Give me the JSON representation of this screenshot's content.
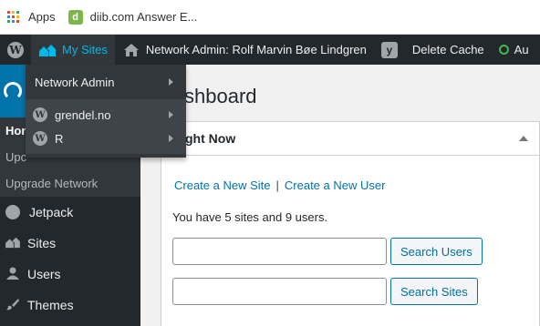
{
  "bookmarks": {
    "apps_label": "Apps",
    "diib_label": "diib.com Answer E..."
  },
  "adminbar": {
    "my_sites": "My Sites",
    "network_admin": "Network Admin: Rolf Marvin Bøe Lindgren",
    "delete_cache": "Delete Cache",
    "au": "Au"
  },
  "dropdown": {
    "network_admin": "Network Admin",
    "sites": [
      {
        "label": "grendel.no"
      },
      {
        "label": "R"
      }
    ]
  },
  "sidebar": {
    "sub": [
      {
        "label": "Hon"
      },
      {
        "label": "Upc"
      },
      {
        "label": "Upgrade Network"
      }
    ],
    "items": [
      {
        "label": "Jetpack"
      },
      {
        "label": "Sites"
      },
      {
        "label": "Users"
      },
      {
        "label": "Themes"
      }
    ]
  },
  "main": {
    "title": "shboard",
    "panel_title": "ght Now",
    "create_site": "Create a New Site",
    "separator": "|",
    "create_user": "Create a New User",
    "stats": "You have 5 sites and 9 users.",
    "search_users_btn": "Search Users",
    "search_sites_btn": "Search Sites"
  },
  "colors": {
    "adminbar_bg": "#23282d",
    "accent": "#0073aa",
    "active_text": "#00b9eb",
    "status_green": "#46b450"
  }
}
